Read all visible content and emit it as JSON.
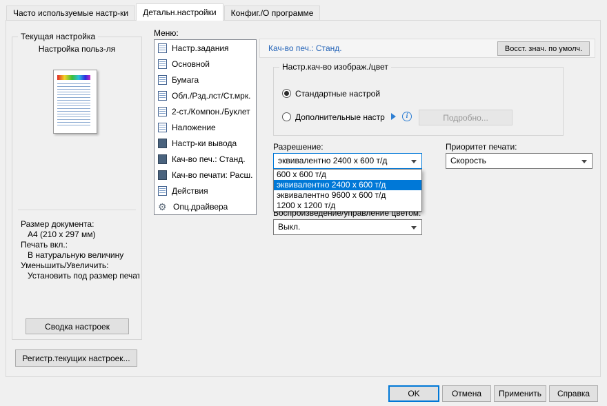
{
  "colors": {
    "accent": "#0078d7",
    "panel_title_text": "#2464b8",
    "selection_bg": "#0078d7"
  },
  "tabs": {
    "items": [
      {
        "label": "Часто используемые настр-ки"
      },
      {
        "label": "Детальн.настройки"
      },
      {
        "label": "Конфиг./О программе"
      }
    ]
  },
  "current_settings": {
    "group_title": "Текущая настройка",
    "profile": "Настройка польз-ля",
    "info_lines": [
      {
        "text": "Размер документа:"
      },
      {
        "text": "A4 (210 x 297 мм)"
      },
      {
        "text": "Печать вкл.:"
      },
      {
        "text": "В натуральную величину"
      },
      {
        "text": "Уменьшить/Увеличить:"
      },
      {
        "text": "Установить под размер печат"
      }
    ],
    "summary_button": "Сводка настроек",
    "register_button": "Регистр.текущих настроек..."
  },
  "menu": {
    "label": "Меню:",
    "items": [
      {
        "label": "Настр.задания",
        "icon": "job-settings-icon"
      },
      {
        "label": "Основной",
        "icon": "basic-settings-icon"
      },
      {
        "label": "Бумага",
        "icon": "paper-icon"
      },
      {
        "label": "Обл./Рзд.лст/Ст.мрк.",
        "icon": "covers-sheets-icon"
      },
      {
        "label": "2-ст./Компон./Буклет",
        "icon": "duplex-layout-icon"
      },
      {
        "label": "Наложение",
        "icon": "overlay-icon"
      },
      {
        "label": "Настр-ки вывода",
        "icon": "output-settings-icon"
      },
      {
        "label": "Кач-во печ.: Станд.",
        "icon": "print-quality-standard-icon"
      },
      {
        "label": "Кач-во печати: Расш.",
        "icon": "print-quality-extended-icon"
      },
      {
        "label": "Действия",
        "icon": "actions-icon"
      },
      {
        "label": "Опц.драйвера",
        "icon": "driver-options-icon"
      }
    ]
  },
  "panel": {
    "title": "Кач-во печ.: Станд.",
    "restore_button": "Восст. знач. по умолч.",
    "quality_group": {
      "title": "Настр.кач-во изображ./цвет",
      "radio_standard": "Стандартные настрой",
      "radio_advanced": "Дополнительные настр",
      "details_button": "Подробно..."
    },
    "resolution": {
      "label": "Разрешение:",
      "value": "эквивалентно 2400 x 600 т/д",
      "options": [
        {
          "label": "600 x 600 т/д",
          "selected": false
        },
        {
          "label": "эквивалентно 2400 x 600 т/д",
          "selected": true
        },
        {
          "label": "эквивалентно 9600 x 600 т/д",
          "selected": false
        },
        {
          "label": "1200 x 1200 т/д",
          "selected": false
        }
      ]
    },
    "priority": {
      "label": "Приоритет печати:",
      "value": "Скорость"
    },
    "color_mgmt": {
      "label": "Воспроизведение/управление цветом:",
      "value": "Выкл."
    }
  },
  "footer": {
    "buttons": [
      {
        "label": "OK"
      },
      {
        "label": "Отмена"
      },
      {
        "label": "Применить"
      },
      {
        "label": "Справка"
      }
    ]
  }
}
